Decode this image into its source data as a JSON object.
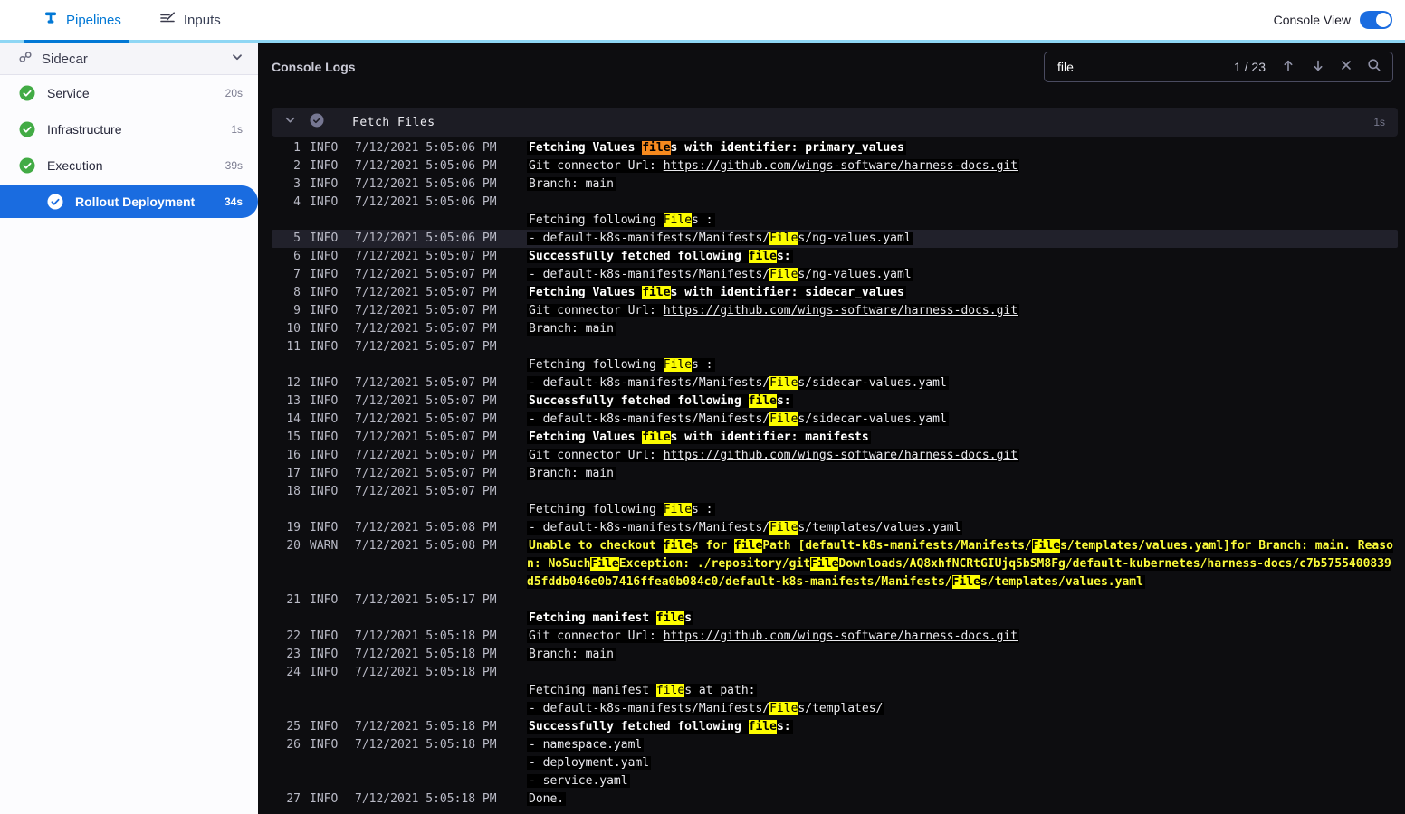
{
  "topbar": {
    "tabs": [
      {
        "label": "Pipelines",
        "active": true
      },
      {
        "label": "Inputs",
        "active": false
      }
    ],
    "console_view_label": "Console View",
    "console_view_on": true
  },
  "sidebar": {
    "stage": {
      "label": "Sidecar"
    },
    "items": [
      {
        "label": "Service",
        "duration": "20s",
        "status": "success",
        "child": false,
        "selected": false
      },
      {
        "label": "Infrastructure",
        "duration": "1s",
        "status": "success",
        "child": false,
        "selected": false
      },
      {
        "label": "Execution",
        "duration": "39s",
        "status": "success",
        "child": false,
        "selected": false
      },
      {
        "label": "Rollout Deployment",
        "duration": "34s",
        "status": "success",
        "child": true,
        "selected": true
      }
    ]
  },
  "console": {
    "title": "Console Logs",
    "search": {
      "term": "file",
      "count": "1 / 23"
    },
    "group": {
      "title": "Fetch Files",
      "duration": "1s"
    },
    "current_match_index": 0,
    "highlighted_row_num": 5,
    "entries": [
      {
        "num": 1,
        "level": "INFO",
        "time": "7/12/2021 5:05:06 PM",
        "lines": [
          {
            "text": "Fetching Values files with identifier: primary_values",
            "bold": true
          }
        ]
      },
      {
        "num": 2,
        "level": "INFO",
        "time": "7/12/2021 5:05:06 PM",
        "lines": [
          {
            "text": "Git connector Url: ",
            "link": "https://github.com/wings-software/harness-docs.git"
          }
        ]
      },
      {
        "num": 3,
        "level": "INFO",
        "time": "7/12/2021 5:05:06 PM",
        "lines": [
          {
            "text": "Branch: main"
          }
        ]
      },
      {
        "num": 4,
        "level": "INFO",
        "time": "7/12/2021 5:05:06 PM",
        "lines": [
          {
            "text": ""
          },
          {
            "text": "Fetching following Files :"
          }
        ]
      },
      {
        "num": 5,
        "level": "INFO",
        "time": "7/12/2021 5:05:06 PM",
        "lines": [
          {
            "text": "- default-k8s-manifests/Manifests/Files/ng-values.yaml"
          }
        ]
      },
      {
        "num": 6,
        "level": "INFO",
        "time": "7/12/2021 5:05:07 PM",
        "lines": [
          {
            "text": "Successfully fetched following files:",
            "bold": true
          }
        ]
      },
      {
        "num": 7,
        "level": "INFO",
        "time": "7/12/2021 5:05:07 PM",
        "lines": [
          {
            "text": "- default-k8s-manifests/Manifests/Files/ng-values.yaml"
          }
        ]
      },
      {
        "num": 8,
        "level": "INFO",
        "time": "7/12/2021 5:05:07 PM",
        "lines": [
          {
            "text": "Fetching Values files with identifier: sidecar_values",
            "bold": true
          }
        ]
      },
      {
        "num": 9,
        "level": "INFO",
        "time": "7/12/2021 5:05:07 PM",
        "lines": [
          {
            "text": "Git connector Url: ",
            "link": "https://github.com/wings-software/harness-docs.git"
          }
        ]
      },
      {
        "num": 10,
        "level": "INFO",
        "time": "7/12/2021 5:05:07 PM",
        "lines": [
          {
            "text": "Branch: main"
          }
        ]
      },
      {
        "num": 11,
        "level": "INFO",
        "time": "7/12/2021 5:05:07 PM",
        "lines": [
          {
            "text": ""
          },
          {
            "text": "Fetching following Files :"
          }
        ]
      },
      {
        "num": 12,
        "level": "INFO",
        "time": "7/12/2021 5:05:07 PM",
        "lines": [
          {
            "text": "- default-k8s-manifests/Manifests/Files/sidecar-values.yaml"
          }
        ]
      },
      {
        "num": 13,
        "level": "INFO",
        "time": "7/12/2021 5:05:07 PM",
        "lines": [
          {
            "text": "Successfully fetched following files:",
            "bold": true
          }
        ]
      },
      {
        "num": 14,
        "level": "INFO",
        "time": "7/12/2021 5:05:07 PM",
        "lines": [
          {
            "text": "- default-k8s-manifests/Manifests/Files/sidecar-values.yaml"
          }
        ]
      },
      {
        "num": 15,
        "level": "INFO",
        "time": "7/12/2021 5:05:07 PM",
        "lines": [
          {
            "text": "Fetching Values files with identifier: manifests",
            "bold": true
          }
        ]
      },
      {
        "num": 16,
        "level": "INFO",
        "time": "7/12/2021 5:05:07 PM",
        "lines": [
          {
            "text": "Git connector Url: ",
            "link": "https://github.com/wings-software/harness-docs.git"
          }
        ]
      },
      {
        "num": 17,
        "level": "INFO",
        "time": "7/12/2021 5:05:07 PM",
        "lines": [
          {
            "text": "Branch: main"
          }
        ]
      },
      {
        "num": 18,
        "level": "INFO",
        "time": "7/12/2021 5:05:07 PM",
        "lines": [
          {
            "text": ""
          },
          {
            "text": "Fetching following Files :"
          }
        ]
      },
      {
        "num": 19,
        "level": "INFO",
        "time": "7/12/2021 5:05:08 PM",
        "lines": [
          {
            "text": "- default-k8s-manifests/Manifests/Files/templates/values.yaml"
          }
        ]
      },
      {
        "num": 20,
        "level": "WARN",
        "time": "7/12/2021 5:05:08 PM",
        "lines": [
          {
            "text": "Unable to checkout files for filePath [default-k8s-manifests/Manifests/Files/templates/values.yaml]for Branch: main. Reason: NoSuchFileException: ./repository/gitFileDownloads/AQ8xhfNCRtGIUjq5bSM8Fg/default-kubernetes/harness-docs/c7b5755400839d5fddb046e0b7416ffea0b084c0/default-k8s-manifests/Manifests/Files/templates/values.yaml",
            "warn": true
          }
        ]
      },
      {
        "num": 21,
        "level": "INFO",
        "time": "7/12/2021 5:05:17 PM",
        "lines": [
          {
            "text": ""
          },
          {
            "text": "Fetching manifest files",
            "bold": true
          }
        ]
      },
      {
        "num": 22,
        "level": "INFO",
        "time": "7/12/2021 5:05:18 PM",
        "lines": [
          {
            "text": "Git connector Url: ",
            "link": "https://github.com/wings-software/harness-docs.git"
          }
        ]
      },
      {
        "num": 23,
        "level": "INFO",
        "time": "7/12/2021 5:05:18 PM",
        "lines": [
          {
            "text": "Branch: main"
          }
        ]
      },
      {
        "num": 24,
        "level": "INFO",
        "time": "7/12/2021 5:05:18 PM",
        "lines": [
          {
            "text": ""
          },
          {
            "text": "Fetching manifest files at path:"
          },
          {
            "text": "- default-k8s-manifests/Manifests/Files/templates/"
          }
        ]
      },
      {
        "num": 25,
        "level": "INFO",
        "time": "7/12/2021 5:05:18 PM",
        "lines": [
          {
            "text": "Successfully fetched following files:",
            "bold": true
          }
        ]
      },
      {
        "num": 26,
        "level": "INFO",
        "time": "7/12/2021 5:05:18 PM",
        "lines": [
          {
            "text": "- namespace.yaml"
          },
          {
            "text": "- deployment.yaml"
          },
          {
            "text": "- service.yaml"
          }
        ]
      },
      {
        "num": 27,
        "level": "INFO",
        "time": "7/12/2021 5:05:18 PM",
        "lines": [
          {
            "text": "Done."
          }
        ]
      }
    ]
  },
  "colors": {
    "tab_blue": "#0278d5",
    "accent_light_blue": "#8ed6f4",
    "selected_blue": "#1a6ce0",
    "success_green": "#42ab45",
    "match_highlight": "#fdfd00",
    "current_match_highlight": "#f78a1e",
    "warn_text": "#fbfb3a",
    "console_bg": "#0d0d10"
  }
}
